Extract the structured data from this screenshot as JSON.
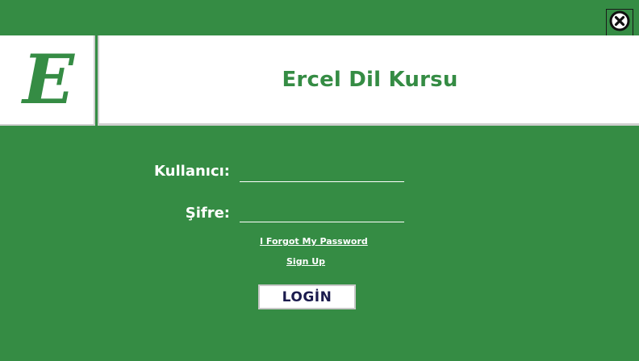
{
  "header": {
    "logo_letter": "E",
    "title": "Ercel Dil Kursu"
  },
  "window": {
    "close_icon": "close-circle-x-icon"
  },
  "form": {
    "username_label": "Kullanıcı:",
    "username_value": "",
    "password_label": "Şifre:",
    "password_value": "",
    "forgot_link": "I Forgot My Password",
    "signup_link": "Sign Up",
    "login_button": "LOGİN"
  },
  "colors": {
    "background": "#358c44",
    "accent_text": "#358c44",
    "button_text": "#1b1b4d",
    "panel": "#ffffff"
  }
}
